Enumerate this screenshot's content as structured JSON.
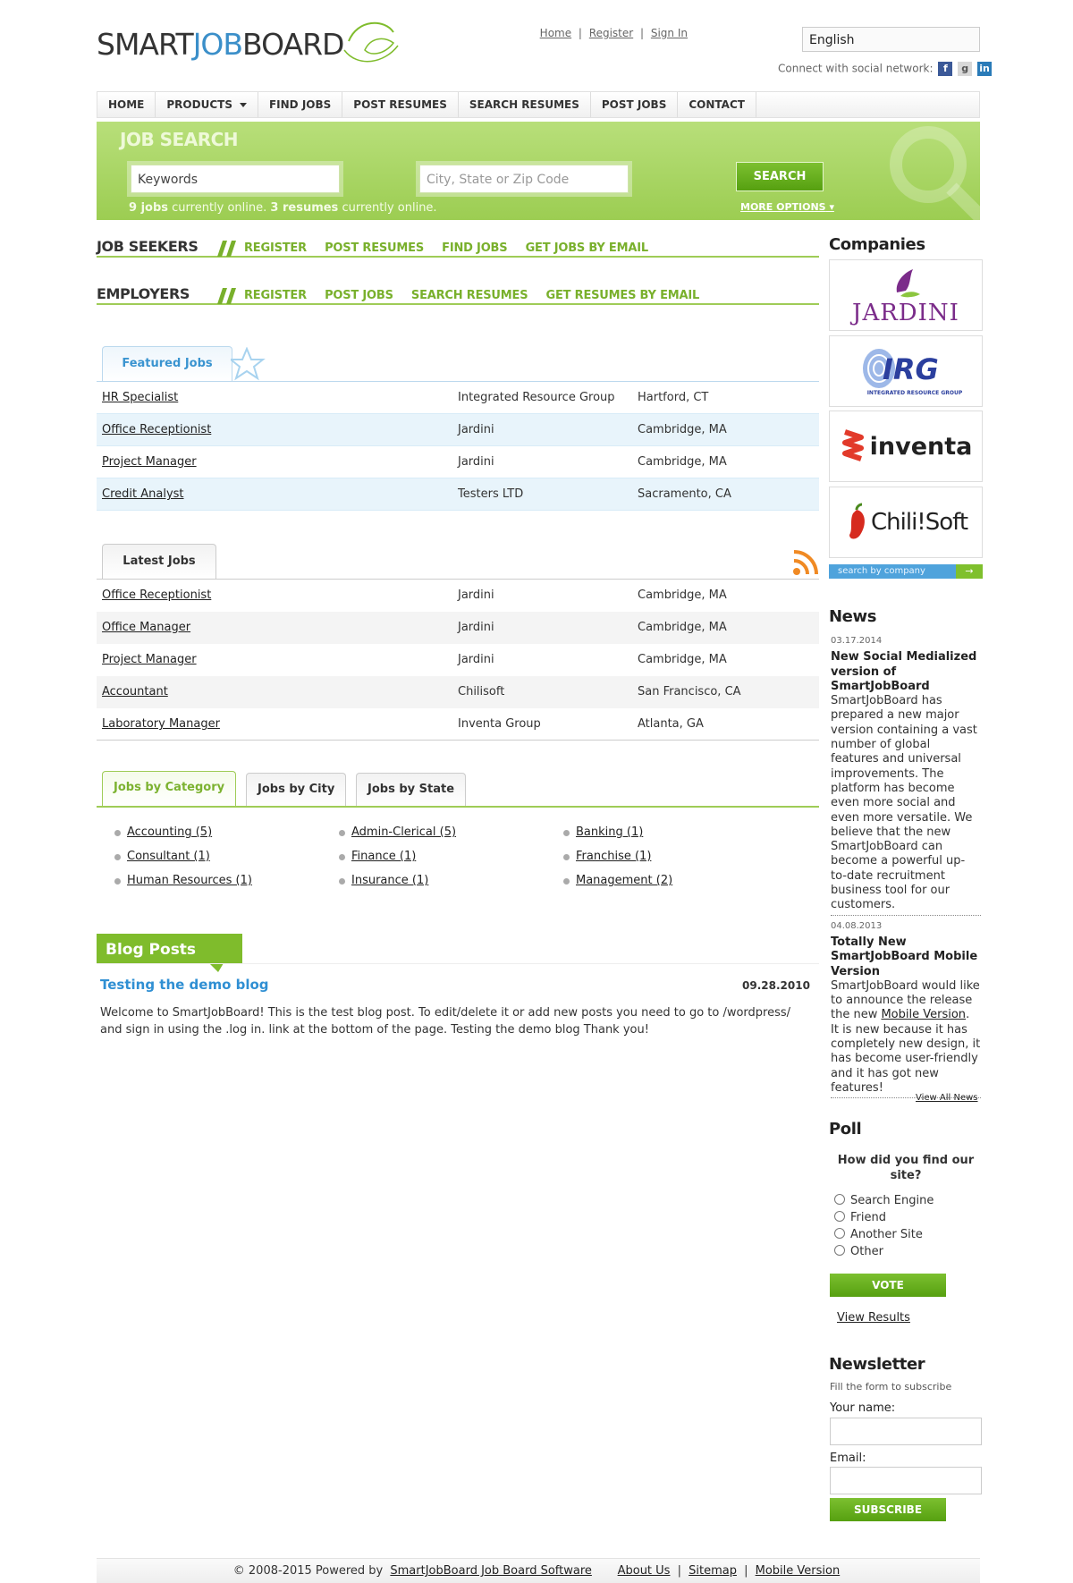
{
  "brand": {
    "part1": "SMART",
    "part2": "JOB",
    "part3": "BOARD"
  },
  "header": {
    "links": [
      "Home",
      "Register",
      "Sign In"
    ],
    "language": "English",
    "social_text": "Connect with social network:",
    "social_icons": [
      "facebook-icon",
      "google-icon",
      "linkedin-icon"
    ]
  },
  "nav": [
    "HOME",
    "PRODUCTS",
    "FIND JOBS",
    "POST RESUMES",
    "SEARCH RESUMES",
    "POST JOBS",
    "CONTACT"
  ],
  "job_search": {
    "title": "JOB SEARCH",
    "keywords": "Keywords",
    "location_placeholder": "City, State or Zip Code",
    "button": "SEARCH",
    "jobs_count": "9 jobs",
    "jobs_text": " currently online. ",
    "resumes_count": "3 resumes",
    "resumes_text": " currently online.",
    "more_options": "MORE OPTIONS"
  },
  "job_seekers": {
    "label": "JOB SEEKERS",
    "links": [
      "REGISTER",
      "POST RESUMES",
      "FIND JOBS",
      "GET JOBS BY EMAIL"
    ]
  },
  "employers": {
    "label": "EMPLOYERS",
    "links": [
      "REGISTER",
      "POST JOBS",
      "SEARCH RESUMES",
      "GET RESUMES BY EMAIL"
    ]
  },
  "featured": {
    "tab": "Featured Jobs",
    "rows": [
      {
        "title": "HR Specialist",
        "company": "Integrated Resource Group",
        "location": "Hartford, CT"
      },
      {
        "title": "Office Receptionist",
        "company": "Jardini",
        "location": "Cambridge, MA"
      },
      {
        "title": "Project Manager",
        "company": "Jardini",
        "location": "Cambridge, MA"
      },
      {
        "title": "Credit Analyst",
        "company": "Testers LTD",
        "location": "Sacramento, CA"
      }
    ]
  },
  "latest": {
    "tab": "Latest Jobs",
    "rows": [
      {
        "title": "Office Receptionist",
        "company": "Jardini",
        "location": "Cambridge, MA"
      },
      {
        "title": "Office Manager",
        "company": "Jardini",
        "location": "Cambridge, MA"
      },
      {
        "title": "Project Manager",
        "company": "Jardini",
        "location": "Cambridge, MA"
      },
      {
        "title": "Accountant",
        "company": "Chilisoft",
        "location": "San Francisco, CA"
      },
      {
        "title": "Laboratory Manager",
        "company": "Inventa Group",
        "location": "Atlanta, GA"
      }
    ]
  },
  "browse": {
    "tabs": [
      "Jobs by Category",
      "Jobs by City",
      "Jobs by State"
    ],
    "categories": [
      "Accounting (5)",
      "Admin-Clerical (5)",
      "Banking (1)",
      "Consultant (1)",
      "Finance (1)",
      "Franchise (1)",
      "Human Resources (1)",
      "Insurance (1)",
      "Management (2)"
    ]
  },
  "blog": {
    "heading": "Blog Posts",
    "post_title": "Testing the demo blog",
    "post_date": "09.28.2010",
    "post_body": "Welcome to SmartJobBoard! This is the test blog post. To edit/delete it or add new posts you need to go to /wordpress/ and sign in using the .log in. link at the bottom of the page. Testing the demo blog Thank you!"
  },
  "companies": {
    "heading": "Companies",
    "logos": [
      "JARDINI",
      "IRG",
      "INTEGRATED RESOURCE GROUP",
      "inventa",
      "Chili!Soft"
    ],
    "search_label": "search by company",
    "search_go": "→"
  },
  "news": {
    "heading": "News",
    "items": [
      {
        "date": "03.17.2014",
        "title": "New Social Medialized version of SmartJobBoard",
        "body": "SmartJobBoard has prepared a new major version containing a vast number of global features and universal improvements. The platform has become even more social and even more versatile. We believe that the new SmartJobBoard can become a powerful up-to-date recruitment business tool for our customers."
      },
      {
        "date": "04.08.2013",
        "title": "Totally New SmartJobBoard Mobile Version",
        "body_pre": "SmartJobBoard would like to announce the release the new ",
        "body_link": "Mobile Version",
        "body_post": ". It is new because it has completely new  design, it has become user-friendly and it has got new features!"
      }
    ],
    "view_all": "View All News"
  },
  "poll": {
    "heading": "Poll",
    "question": "How did you find our site?",
    "options": [
      "Search Engine",
      "Friend",
      "Another Site",
      "Other"
    ],
    "vote": "VOTE",
    "results": "View Results"
  },
  "newsletter": {
    "heading": "Newsletter",
    "sub": "Fill the form to subscribe",
    "name_label": "Your name:",
    "email_label": "Email:",
    "button": "SUBSCRIBE"
  },
  "footer": {
    "copyright": "© 2008-2015 Powered by ",
    "powered_link": "SmartJobBoard Job Board Software",
    "links": [
      "About Us",
      "Sitemap",
      "Mobile Version"
    ]
  }
}
